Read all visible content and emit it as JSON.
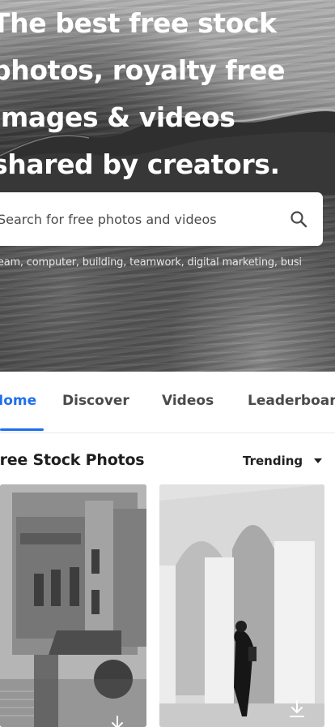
{
  "hero": {
    "title_lines": [
      "The best free stock",
      "photos, royalty free",
      "images & videos",
      "shared by creators."
    ]
  },
  "search": {
    "placeholder": "Search for free photos and videos",
    "value": ""
  },
  "suggestions": "team, computer, building, teamwork, digital marketing, busi",
  "tabs": [
    {
      "label": "Home",
      "active": true
    },
    {
      "label": "Discover",
      "active": false
    },
    {
      "label": "Videos",
      "active": false
    },
    {
      "label": "Leaderboard",
      "active": false
    }
  ],
  "section": {
    "title": "Free Stock Photos",
    "sort_label": "Trending"
  },
  "colors": {
    "accent": "#1f6feb",
    "text_dark": "#1f1f1f",
    "tab_text": "#4a4a4a"
  },
  "icons": {
    "search": "search-icon",
    "sort": "chevron-down-icon",
    "download": "download-icon"
  }
}
